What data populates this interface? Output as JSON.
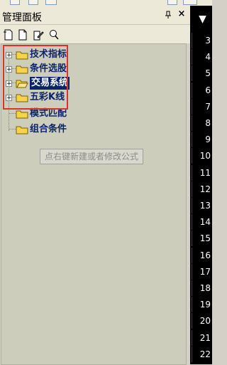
{
  "panel": {
    "title": "管理面板",
    "pin_icon": "pin-icon",
    "close_symbol": "×"
  },
  "toolbar": {
    "buttons": [
      {
        "name": "new-icon"
      },
      {
        "name": "open-icon"
      },
      {
        "name": "edit-icon"
      },
      {
        "name": "search-icon"
      }
    ]
  },
  "tree": {
    "items": [
      {
        "label": "技术指标",
        "expandable": true,
        "expander": "+"
      },
      {
        "label": "条件选股",
        "expandable": true,
        "expander": "+"
      },
      {
        "label": "交易系统",
        "expandable": true,
        "expander": "+",
        "selected": true
      },
      {
        "label": "五彩K线",
        "expandable": true,
        "expander": "+"
      },
      {
        "label": "模式匹配",
        "expandable": false
      },
      {
        "label": "组合条件",
        "expandable": false
      }
    ],
    "hint": "点右键新建或者修改公式"
  },
  "right_column": {
    "header": "▼",
    "row_numbers": [
      "3",
      "4",
      "5",
      "6",
      "7",
      "8",
      "9",
      "10",
      "11",
      "12",
      "13",
      "14",
      "15",
      "16",
      "17",
      "18",
      "19",
      "20",
      "21",
      "22"
    ]
  },
  "colors": {
    "highlight_box": "#e0302c",
    "selection": "#0a246a",
    "tree_bg": "#cdcdbb"
  }
}
